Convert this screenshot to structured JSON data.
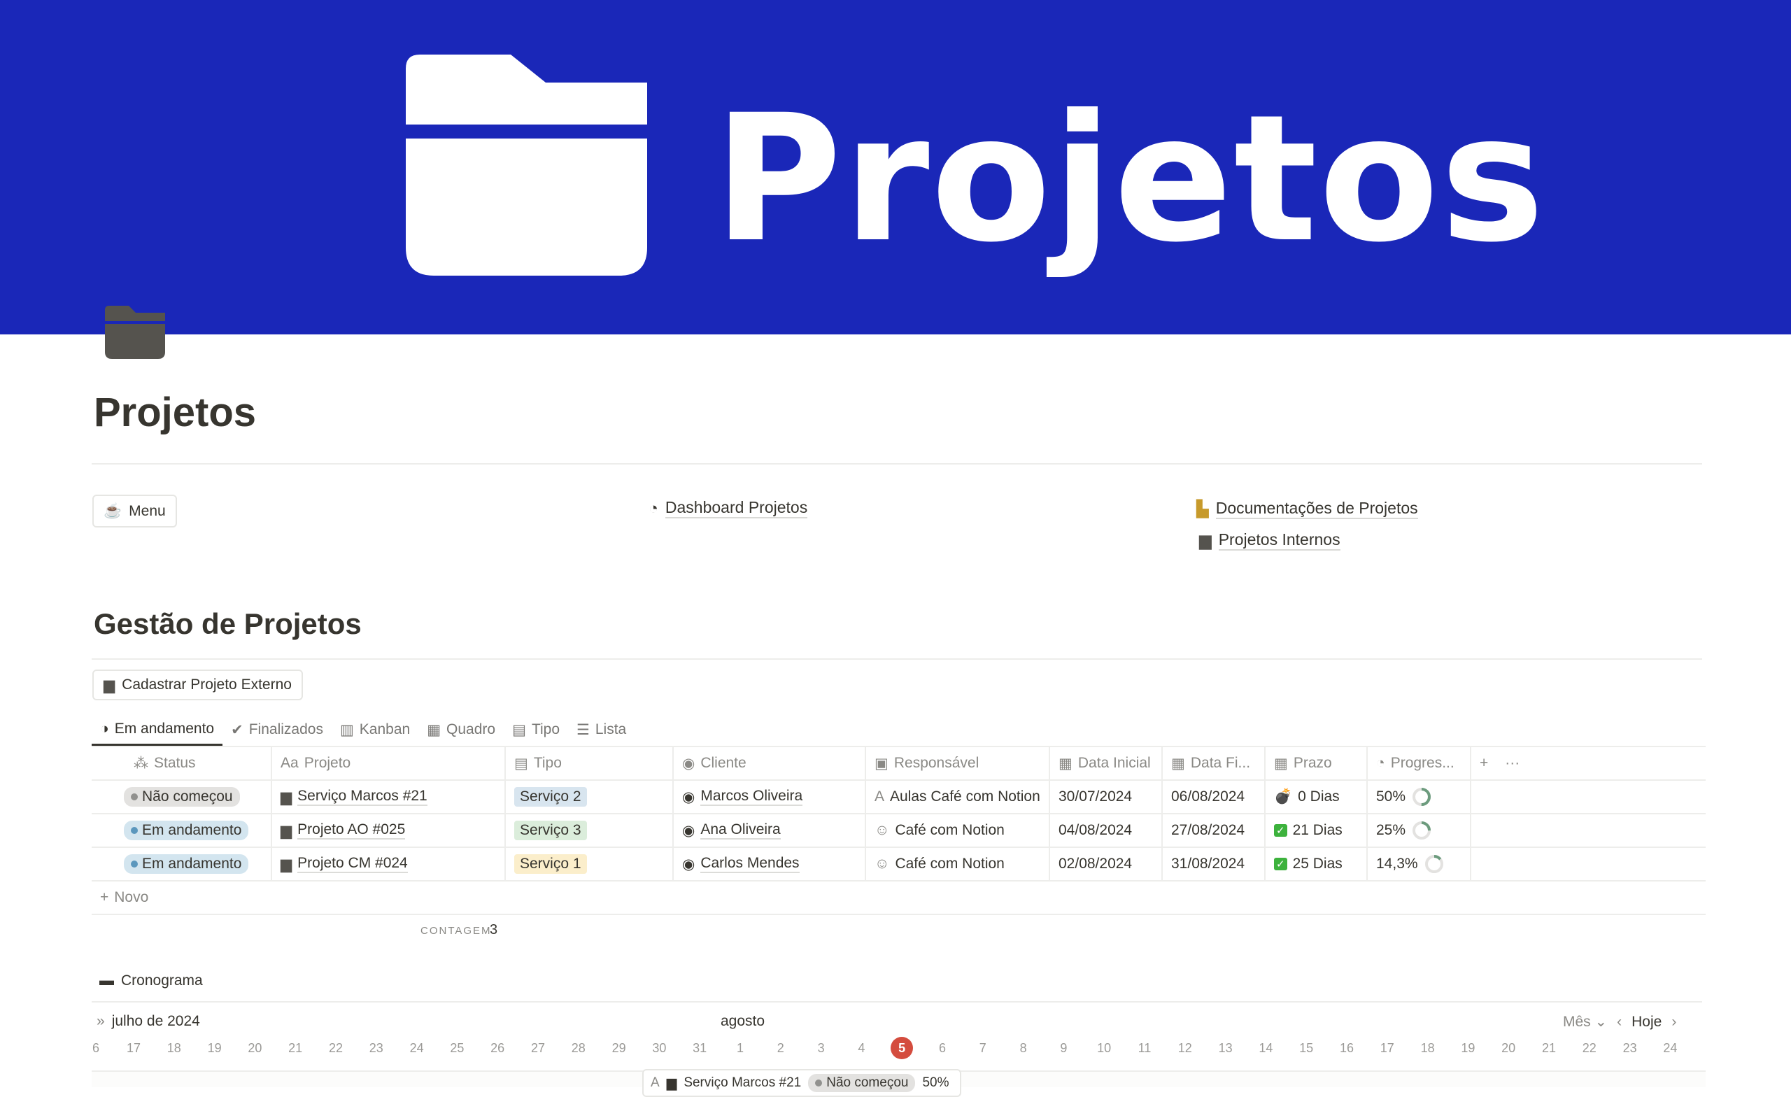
{
  "banner": {
    "logo_text": "Projetos",
    "color": "#1a27b8"
  },
  "page": {
    "title": "Projetos",
    "icon": "folder-icon"
  },
  "links": {
    "menu": "Menu",
    "dashboard": "Dashboard Projetos",
    "docs": "Documentações de Projetos",
    "internos": "Projetos Internos"
  },
  "section": {
    "title": "Gestão de Projetos",
    "new_button": "Cadastrar Projeto Externo"
  },
  "tabs": [
    "Em andamento",
    "Finalizados",
    "Kanban",
    "Quadro",
    "Tipo",
    "Lista"
  ],
  "table": {
    "columns": [
      "Status",
      "Projeto",
      "Tipo",
      "Cliente",
      "Responsável",
      "Data Inicial",
      "Data Fi...",
      "Prazo",
      "Progres..."
    ],
    "rows": [
      {
        "status": "Não começou",
        "projeto": "Serviço Marcos #21",
        "tipo": "Serviço 2",
        "cliente": "Marcos Oliveira",
        "responsavel": "Aulas Café com Notion",
        "data_inicial": "30/07/2024",
        "data_final": "06/08/2024",
        "prazo": "0 Dias",
        "prazo_icon": "bomb-icon",
        "progresso": "50%",
        "progress_value": 0.5
      },
      {
        "status": "Em andamento",
        "projeto": "Projeto AO #025",
        "tipo": "Serviço 3",
        "cliente": "Ana Oliveira",
        "responsavel": "Café com Notion",
        "data_inicial": "04/08/2024",
        "data_final": "27/08/2024",
        "prazo": "21 Dias",
        "prazo_icon": "check-icon",
        "progresso": "25%",
        "progress_value": 0.25
      },
      {
        "status": "Em andamento",
        "projeto": "Projeto CM #024",
        "tipo": "Serviço 1",
        "cliente": "Carlos Mendes",
        "responsavel": "Café com Notion",
        "data_inicial": "02/08/2024",
        "data_final": "31/08/2024",
        "prazo": "25 Dias",
        "prazo_icon": "check-icon",
        "progresso": "14,3%",
        "progress_value": 0.143
      }
    ],
    "new_row": "Novo",
    "count_label": "CONTAGEM",
    "count_value": "3"
  },
  "timeline": {
    "title": "Cronograma",
    "month_left": "julho de 2024",
    "month_center": "agosto",
    "view": "Mês",
    "today": "Hoje",
    "days": [
      "6",
      "17",
      "18",
      "19",
      "20",
      "21",
      "22",
      "23",
      "24",
      "25",
      "26",
      "27",
      "28",
      "29",
      "30",
      "31",
      "1",
      "2",
      "3",
      "4",
      "5",
      "6",
      "7",
      "8",
      "9",
      "10",
      "11",
      "12",
      "13",
      "14",
      "15",
      "16",
      "17",
      "18",
      "19",
      "20",
      "21",
      "22",
      "23",
      "24"
    ],
    "today_day": "5",
    "bar": {
      "projeto": "Serviço Marcos #21",
      "status": "Não começou",
      "progresso": "50%"
    }
  }
}
